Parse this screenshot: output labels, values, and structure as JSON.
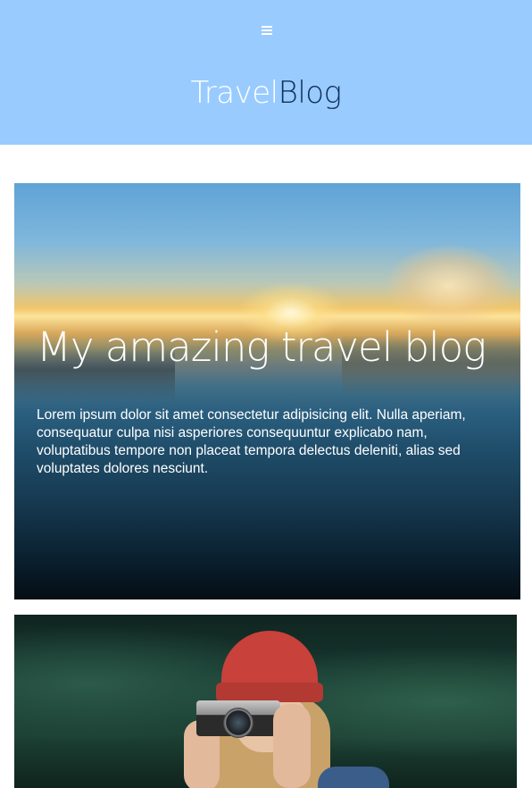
{
  "header": {
    "menu_icon": "hamburger-menu-icon",
    "logo_part1": "Travel",
    "logo_part2": "Blog"
  },
  "hero": {
    "title": "My amazing travel blog",
    "text": "Lorem ipsum dolor sit amet consectetur adipisicing elit. Nulla aperiam, consequatur culpa nisi asperiores consequuntur explicabo nam, voluptatibus tempore non placeat tempora delectus deleniti, alias sed voluptates dolores nesciunt."
  },
  "colors": {
    "header_bg": "#99cbff",
    "logo_dark": "#0f2f5a",
    "page_bg": "#ffffff"
  }
}
